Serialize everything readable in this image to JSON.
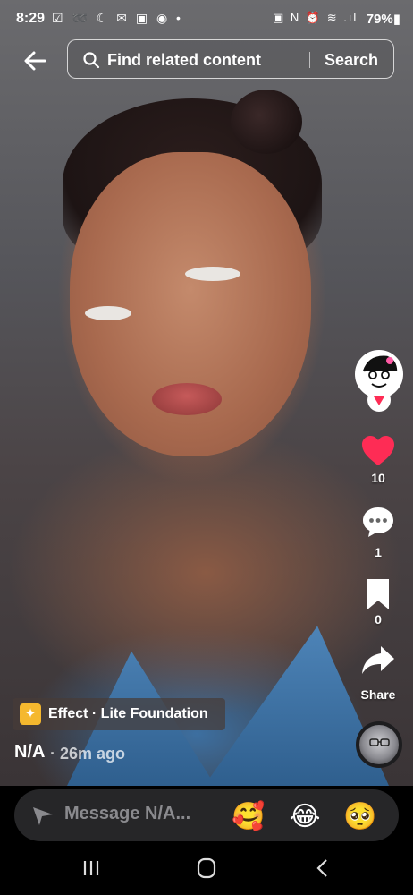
{
  "status_bar": {
    "time": "8:29",
    "left_icons": "☑ ➿ ☾ ✉ ▣ ◉ •",
    "right_icons": "▣ N ⏰ ≋ .ıl",
    "battery": "79%▮"
  },
  "search": {
    "placeholder": "Find related content",
    "button_label": "Search"
  },
  "actions": {
    "likes": "10",
    "comments": "1",
    "saves": "0",
    "share_label": "Share"
  },
  "caption": {
    "effect_label": "Effect · Lite Foundation",
    "author": "N/A",
    "time": "· 26m ago"
  },
  "message_bar": {
    "placeholder": "Message N/A...",
    "emojis": [
      "🥰",
      "😂",
      "🥺"
    ]
  },
  "colors": {
    "like": "#fe2c55",
    "effect_icon": "#f5b82e",
    "message_box": "#262628"
  }
}
